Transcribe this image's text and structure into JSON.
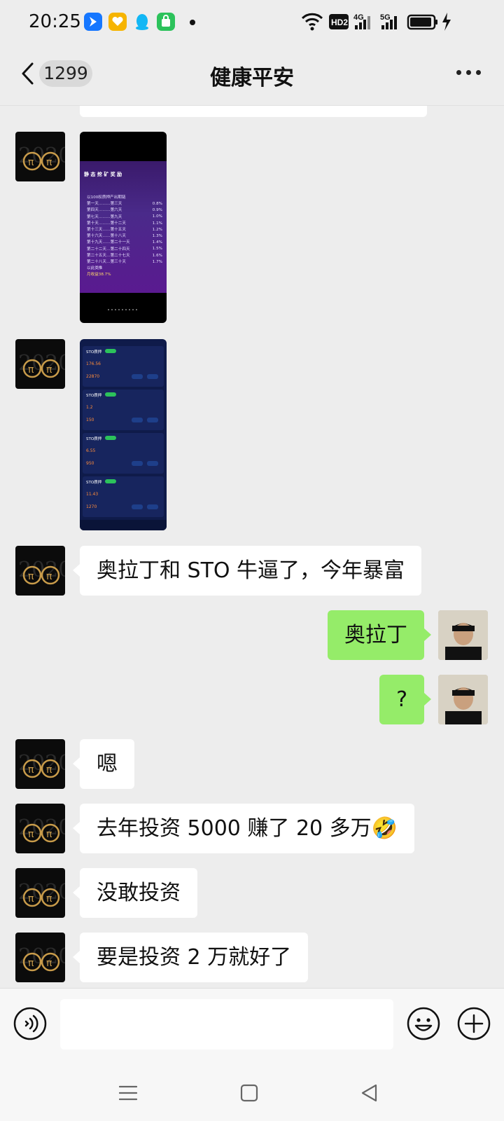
{
  "status_bar": {
    "time": "20:25",
    "network_labels": [
      "HD2",
      "4G",
      "5G"
    ]
  },
  "header": {
    "unread_count": "1299",
    "title": "健康平安"
  },
  "messages": [
    {
      "sender": "other",
      "type": "image",
      "image_title": "静 态 挖 矿 奖 励",
      "image_lines": [
        "以100权质押产出期链",
        "第一天………第三天",
        "第四天………第六天",
        "第七天………第九天",
        "第十天………第十二天",
        "第十三天……第十五天",
        "第十六天……第十八天",
        "第十九天……第二十一天",
        "第二十二天…第二十四天",
        "第二十五天…第二十七天",
        "第二十八天…第三十天",
        "以此类推",
        "月收益38.7%"
      ],
      "image_rates": [
        "0.8%",
        "0.9%",
        "1.0%",
        "1.1%",
        "1.2%",
        "1.3%",
        "1.4%",
        "1.5%",
        "1.6%",
        "1.7%"
      ]
    },
    {
      "sender": "other",
      "type": "image",
      "image_rows": [
        {
          "title": "STO质押",
          "value": "176.56",
          "value2": "22870",
          "unit": "STO"
        },
        {
          "title": "STO质押",
          "value": "1.2",
          "value2": "150",
          "unit": "STO"
        },
        {
          "title": "STO质押",
          "value": "6.55",
          "value2": "950",
          "unit": "STO"
        },
        {
          "title": "STO质押",
          "value": "11.43",
          "value2": "1270",
          "unit": "STO"
        }
      ]
    },
    {
      "sender": "other",
      "type": "text",
      "text": "奥拉丁和 STO 牛逼了，今年暴富"
    },
    {
      "sender": "me",
      "type": "text",
      "text": "奥拉丁"
    },
    {
      "sender": "me",
      "type": "text",
      "text": "?"
    },
    {
      "sender": "other",
      "type": "text",
      "text": "嗯"
    },
    {
      "sender": "other",
      "type": "text",
      "text": "去年投资 5000 赚了 20 多万",
      "emoji": "🤣"
    },
    {
      "sender": "other",
      "type": "text",
      "text": "没敢投资"
    },
    {
      "sender": "other",
      "type": "text",
      "text": "要是投资 2 万就好了"
    }
  ],
  "input_bar": {
    "placeholder": "",
    "icons": [
      "voice-icon",
      "emoji-icon",
      "plus-icon"
    ]
  },
  "system_nav": {
    "icons": [
      "menu-icon",
      "home-icon",
      "back-icon"
    ]
  },
  "colors": {
    "background": "#ededed",
    "bubble_out": "#95ec69",
    "bubble_in": "#ffffff"
  }
}
